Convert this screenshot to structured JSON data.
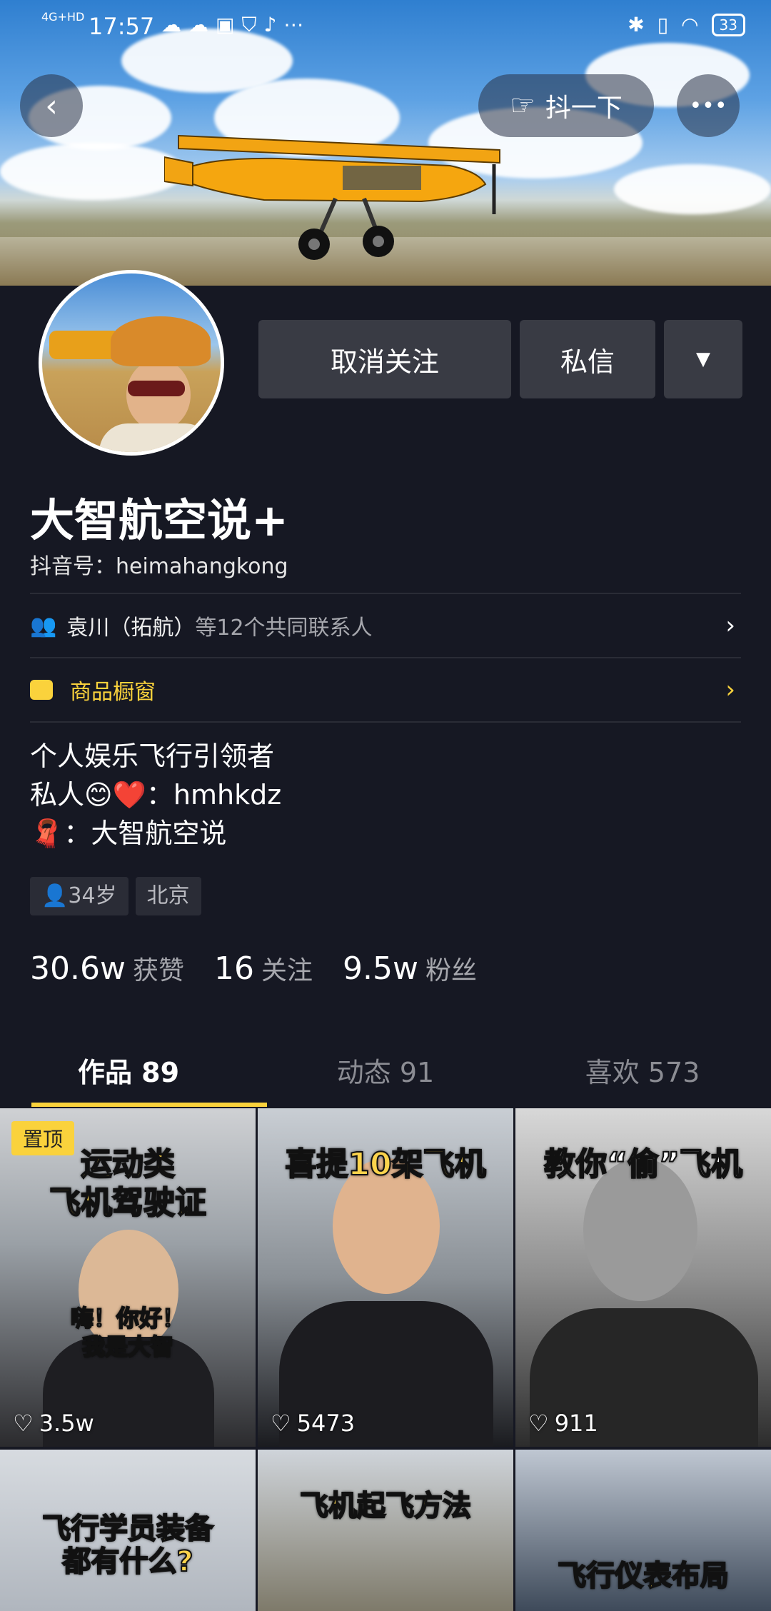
{
  "status_bar": {
    "time": "17:57",
    "network": "4G+HD",
    "battery": "33",
    "left_icons": [
      "cloud-icon",
      "cloud-icon",
      "app-icon",
      "shield-icon",
      "tiktok-icon",
      "more-icon"
    ],
    "right_icons": [
      "bluetooth-icon",
      "vibrate-icon",
      "wifi-icon"
    ]
  },
  "header": {
    "back_icon": "‹",
    "shake_label": "抖一下",
    "more_icon": "•••"
  },
  "profile": {
    "unfollow_label": "取消关注",
    "message_label": "私信",
    "dropdown_icon": "▼",
    "name": "大智航空说+",
    "douyin_id": "抖音号：heimahangkong",
    "contacts_name": "袁川（拓航）",
    "contacts_suffix": "等12个共同联系人",
    "shop_label": "商品橱窗",
    "bio_lines": [
      "个人娱乐飞行引领者",
      "私人😊❤️：hmhkdz",
      "🧣：大智航空说"
    ],
    "tags": [
      "34岁",
      "北京"
    ],
    "stats": [
      {
        "value": "30.6w",
        "label": "获赞"
      },
      {
        "value": "16",
        "label": "关注"
      },
      {
        "value": "9.5w",
        "label": "粉丝"
      }
    ]
  },
  "tabs": [
    {
      "label": "作品 89",
      "active": true
    },
    {
      "label": "动态 91",
      "active": false
    },
    {
      "label": "喜欢 573",
      "active": false
    }
  ],
  "videos": [
    {
      "title": "运动类\n飞机驾驶证",
      "overlay": "嗨！你好！\n我是大智",
      "likes": "3.5w",
      "pinned": "置顶"
    },
    {
      "title": "喜提10架飞机",
      "likes": "5473"
    },
    {
      "title": "教你“偷”飞机",
      "likes": "911"
    },
    {
      "title": "飞行学员装备\n都有什么?"
    },
    {
      "title": "飞机起飞方法"
    },
    {
      "title": "飞行仪表布局"
    }
  ],
  "colors": {
    "background": "#161823",
    "accent": "#fad23c",
    "button": "#393b44",
    "title_yellow": "#fbd34c"
  }
}
